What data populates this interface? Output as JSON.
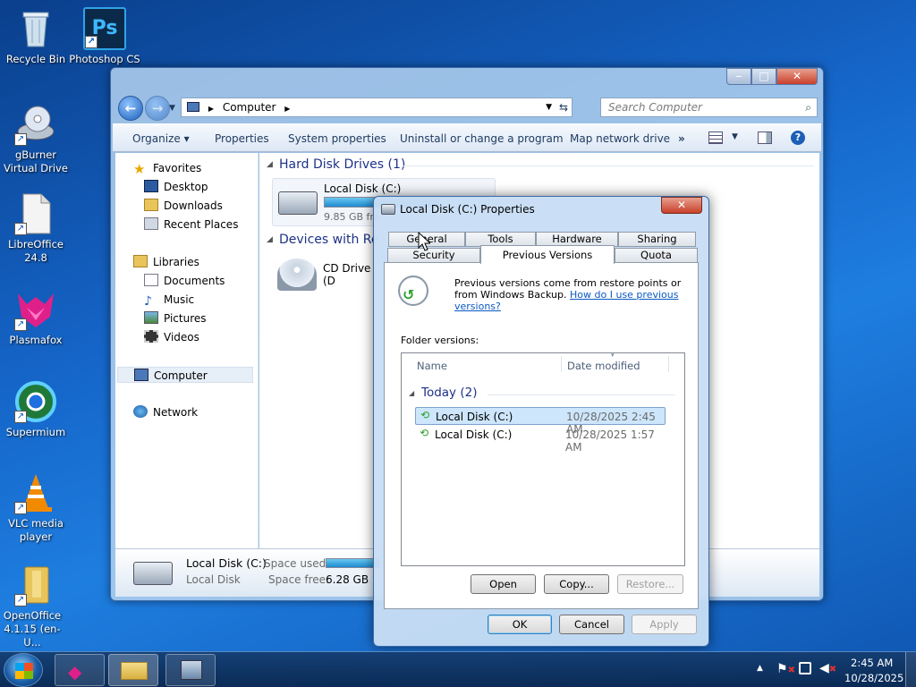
{
  "desktop": {
    "icons": [
      {
        "label": "Recycle Bin"
      },
      {
        "label": "Photoshop CS"
      },
      {
        "label": "gBurner Virtual Drive"
      },
      {
        "label": "LibreOffice 24.8"
      },
      {
        "label": "Plasmafox"
      },
      {
        "label": "Supermium"
      },
      {
        "label": "VLC media player"
      },
      {
        "label": "OpenOffice 4.1.15 (en-U..."
      }
    ]
  },
  "explorer": {
    "window_buttons": {
      "minimize": "‒",
      "maximize": "□",
      "close": "✕"
    },
    "address": "Computer",
    "search_placeholder": "Search Computer",
    "toolbar": {
      "organize": "Organize ▾",
      "properties": "Properties",
      "system_properties": "System properties",
      "uninstall": "Uninstall or change a program",
      "map_drive": "Map network drive",
      "more": "»"
    },
    "sidebar": {
      "favorites": "Favorites",
      "desktop": "Desktop",
      "downloads": "Downloads",
      "recent": "Recent Places",
      "libraries": "Libraries",
      "documents": "Documents",
      "music": "Music",
      "pictures": "Pictures",
      "videos": "Videos",
      "computer": "Computer",
      "network": "Network"
    },
    "groups": {
      "hdd": "Hard Disk Drives (1)",
      "removable": "Devices with Re"
    },
    "drives": {
      "c_name": "Local Disk (C:)",
      "c_free": "9.85 GB fre",
      "cd_name": "CD Drive (D"
    },
    "details": {
      "name": "Local Disk (C:)",
      "type": "Local Disk",
      "space_used_label": "Space used:",
      "space_free_label": "Space free:",
      "space_free": "6.28 GB"
    }
  },
  "dialog": {
    "title": "Local Disk (C:) Properties",
    "close": "✕",
    "tabs_row1": [
      "General",
      "Tools",
      "Hardware",
      "Sharing"
    ],
    "tabs_row2": [
      "Security",
      "Previous Versions",
      "Quota"
    ],
    "active_tab": "Previous Versions",
    "info_text": "Previous versions come from restore points or from Windows Backup.",
    "help_link": "How do I use previous versions?",
    "folder_versions_label": "Folder versions:",
    "columns": {
      "name": "Name",
      "date": "Date modified"
    },
    "group_label": "Today (2)",
    "versions": [
      {
        "name": "Local Disk (C:)",
        "date": "10/28/2025 2:45 AM",
        "selected": true
      },
      {
        "name": "Local Disk (C:)",
        "date": "10/28/2025 1:57 AM",
        "selected": false
      }
    ],
    "buttons": {
      "open": "Open",
      "copy": "Copy...",
      "restore": "Restore...",
      "ok": "OK",
      "cancel": "Cancel",
      "apply": "Apply"
    }
  },
  "taskbar": {
    "clock_time": "2:45 AM",
    "clock_date": "10/28/2025",
    "tray_arrow": "▲"
  },
  "colors": {
    "link": "#0a58c4",
    "selection": "#cde6fb",
    "accent": "#1e3287"
  }
}
